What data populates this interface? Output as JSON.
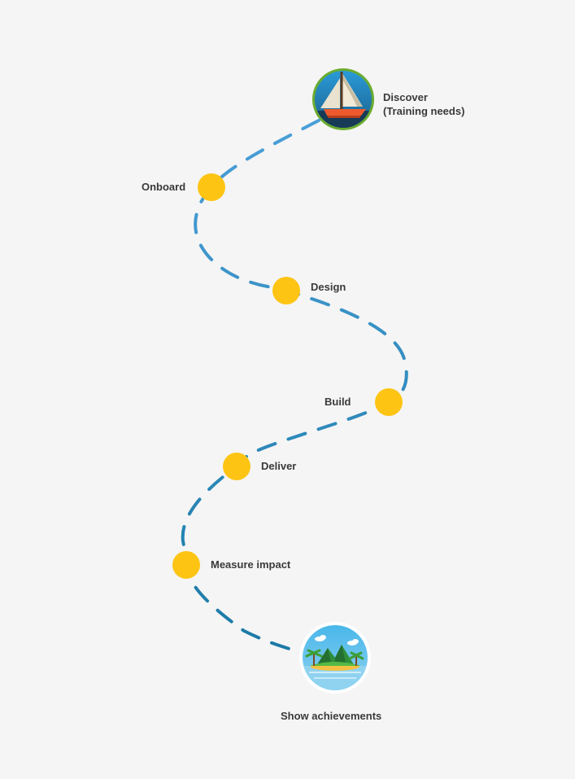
{
  "colors": {
    "background": "#f5f5f5",
    "path_top": "#4a9fd8",
    "path_bottom": "#1b7aa6",
    "milestone": "#fdc414",
    "label": "#3a3a3a",
    "start_ring": "#6aab2f"
  },
  "start": {
    "icon": "sailboat-icon",
    "label_line1": "Discover",
    "label_line2": "(Training needs)"
  },
  "milestones": [
    {
      "label": "Onboard"
    },
    {
      "label": "Design"
    },
    {
      "label": "Build"
    },
    {
      "label": "Deliver"
    },
    {
      "label": "Measure impact"
    }
  ],
  "end": {
    "icon": "island-icon",
    "label": "Show achievements"
  }
}
